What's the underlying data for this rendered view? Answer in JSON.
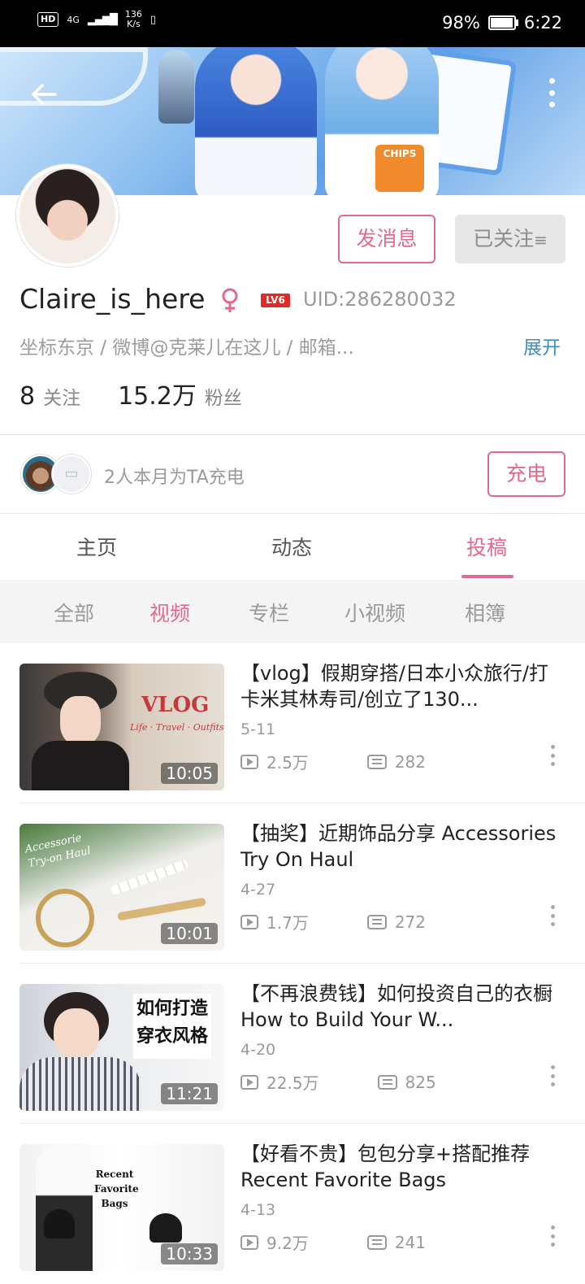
{
  "status_bar": {
    "hd": "HD",
    "network_type": "4G",
    "speed_value": "136",
    "speed_unit": "K/s",
    "battery": "98%",
    "battery_level": 0.98,
    "time": "6:22"
  },
  "profile": {
    "username": "Claire_is_here",
    "level_badge": "LV6",
    "uid": "UID:286280032",
    "bio": "坐标东京 / 微博@克莱儿在这儿 / 邮箱...",
    "expand_label": "展开",
    "following_count": "8",
    "following_label": "关注",
    "followers_count": "15.2万",
    "followers_label": "粉丝",
    "message_button": "发消息",
    "followed_button": "已关注",
    "followed_menu_glyph": "≡"
  },
  "charge": {
    "text": "2人本月为TA充电",
    "button": "充电"
  },
  "tabs": [
    {
      "label": "主页"
    },
    {
      "label": "动态"
    },
    {
      "label": "投稿"
    }
  ],
  "subtabs": [
    {
      "label": "全部"
    },
    {
      "label": "视频"
    },
    {
      "label": "专栏"
    },
    {
      "label": "小视频"
    },
    {
      "label": "相簿"
    }
  ],
  "banner": {
    "chips_text": "CHIPS"
  },
  "videos": [
    {
      "title": "【vlog】假期穿搭/日本小众旅行/打卡米其林寿司/创立了130...",
      "date": "5-11",
      "views": "2.5万",
      "danmaku": "282",
      "duration": "10:05",
      "thumb_text": "VLOG",
      "thumb_sub": "Life · Travel · Outfits"
    },
    {
      "title": "【抽奖】近期饰品分享 Accessories Try On Haul",
      "date": "4-27",
      "views": "1.7万",
      "danmaku": "272",
      "duration": "10:01",
      "thumb_text": "Accessorie Try-on Haul"
    },
    {
      "title": "【不再浪费钱】如何投资自己的衣橱 How to Build Your W...",
      "date": "4-20",
      "views": "22.5万",
      "danmaku": "825",
      "duration": "11:21",
      "thumb_text": "如何打造穿衣风格"
    },
    {
      "title": "【好看不贵】包包分享+搭配推荐 Recent Favorite Bags",
      "date": "4-13",
      "views": "9.2万",
      "danmaku": "241",
      "duration": "10:33",
      "thumb_text": "Recent Favorite Bags"
    }
  ],
  "colors": {
    "accent": "#e26a8c",
    "link": "#3e8ebd",
    "status_bar_bg": "#000000"
  },
  "icons": [
    "back-arrow-icon",
    "more-vertical-icon",
    "female-icon",
    "play-count-icon",
    "danmaku-icon",
    "bilibili-tv-icon"
  ]
}
